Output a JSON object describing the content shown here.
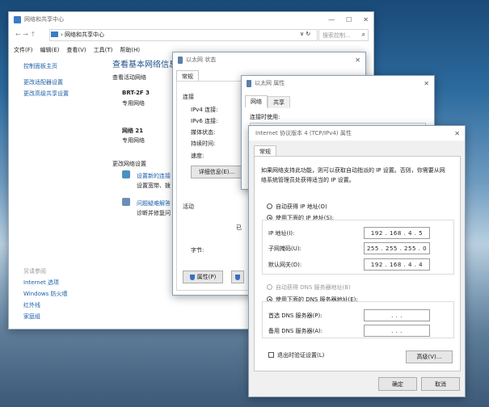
{
  "main": {
    "title": "网络和共享中心",
    "nav": {
      "arrows": "← → ↑",
      "breadcrumb": "网络和共享中心",
      "search_placeholder": "搜索控制... "
    },
    "menu": [
      "文件(F)",
      "编辑(E)",
      "查看(V)",
      "工具(T)",
      "帮助(H)"
    ],
    "sidebar": {
      "items": [
        "控制面板主页",
        "更改适配器设置",
        "更改高级共享设置"
      ],
      "see_also_heading": "另请参阅",
      "see_also": [
        "Internet 选项",
        "Windows 防火墙",
        "红外线",
        "家庭组"
      ]
    },
    "content": {
      "heading": "查看基本网络信息",
      "active_networks": "查看活动网络",
      "networks": [
        {
          "name": "BRT-2F 3",
          "type": "专用网络"
        },
        {
          "name": "网络 21",
          "type": "专用网络"
        }
      ],
      "change_settings": "更改网络设置",
      "tasks": [
        {
          "title": "设置新的连接",
          "desc": "设置宽带、拨"
        },
        {
          "title": "问题疑难解答",
          "desc": "诊断并修复问"
        }
      ]
    }
  },
  "status": {
    "title": "以太网 状态",
    "tab": "常规",
    "connection_heading": "连接",
    "rows": [
      "IPv4 连接:",
      "IPv6 连接:",
      "媒体状态:",
      "持续时间:",
      "速度:"
    ],
    "details_button": "详细信息(E)...",
    "activity_heading": "活动",
    "sent_partial": "已",
    "bytes_label": "字节:",
    "properties_button": "属性(P)"
  },
  "props": {
    "title": "以太网 属性",
    "tabs": [
      "网络",
      "共享"
    ],
    "connect_using": "连接时使用:"
  },
  "ipv4": {
    "title": "Internet 协议版本 4 (TCP/IPv4) 属性",
    "tab": "常规",
    "description_line1": "如果网络支持此功能，则可以获取自动指派的 IP 设置。否则，你需要从网",
    "description_line2": "络系统管理员处获得适当的 IP 设置。",
    "auto_ip": "自动获得 IP 地址(O)",
    "manual_ip": "使用下面的 IP 地址(S):",
    "ip_label": "IP 地址(I):",
    "ip_value": "192 . 168 .  4  .  5",
    "mask_label": "子网掩码(U):",
    "mask_value": "255 . 255 . 255 .  0",
    "gateway_label": "默认网关(D):",
    "gateway_value": "192 . 168 .  4  .  4",
    "auto_dns": "自动获得 DNS 服务器地址(B)",
    "manual_dns": "使用下面的 DNS 服务器地址(E):",
    "pref_dns_label": "首选 DNS 服务器(P):",
    "pref_dns_value": ".       .       .",
    "alt_dns_label": "备用 DNS 服务器(A):",
    "alt_dns_value": ".       .       .",
    "validate": "退出时验证设置(L)",
    "advanced_button": "高级(V)...",
    "ok_button": "确定",
    "cancel_button": "取消"
  },
  "colors": {
    "link": "#1c5fa8",
    "heading": "#1e4f8a"
  }
}
